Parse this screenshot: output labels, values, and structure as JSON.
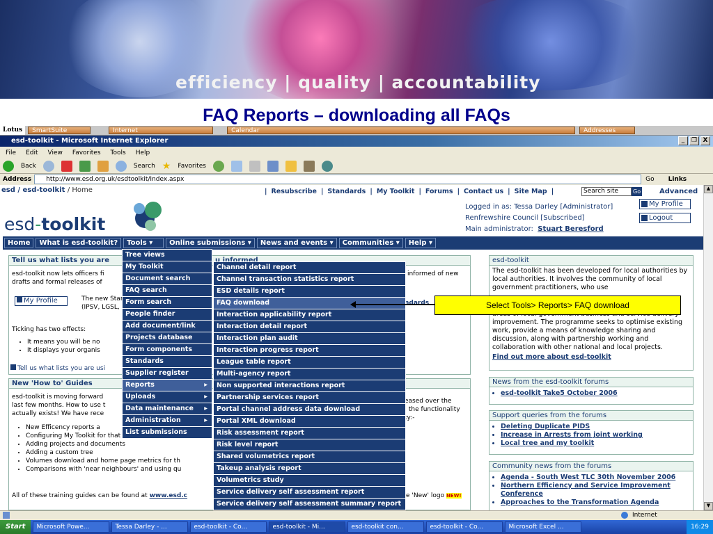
{
  "banner": {
    "tagline": "efficiency | quality | accountability"
  },
  "slide_title": "FAQ Reports – downloading all FAQs",
  "lotus_bar": {
    "brand": "Lotus",
    "items": [
      "SmartSuite",
      "Internet",
      "Calendar",
      "Addresses"
    ]
  },
  "window": {
    "title": "esd-toolkit - Microsoft Internet Explorer",
    "buttons": [
      "_",
      "❐",
      "X"
    ]
  },
  "menubar": [
    "File",
    "Edit",
    "View",
    "Favorites",
    "Tools",
    "Help"
  ],
  "toolbar": {
    "back": "Back",
    "search": "Search",
    "favorites": "Favorites"
  },
  "address": {
    "label": "Address",
    "url": "http://www.esd.org.uk/esdtoolkit/Index.aspx",
    "go": "Go",
    "links": "Links"
  },
  "site": {
    "crumb_root": "esd / esd-toolkit",
    "crumb_home": "/ Home",
    "toplinks": [
      "Resubscribe",
      "Standards",
      "My Toolkit",
      "Forums",
      "Contact us",
      "Site Map"
    ],
    "search_placeholder": "Search site",
    "search_go": "Go",
    "advanced": "Advanced",
    "logo_a": "esd",
    "logo_dash": "-",
    "logo_b": "toolkit",
    "logged_in": "Logged in as: Tessa Darley  [Administrator]",
    "council": "Renfrewshire Council  [Subscribed]",
    "main_admin_label": "Main administrator:",
    "main_admin": "Stuart Beresford",
    "my_profile": "My Profile",
    "logout": "Logout",
    "nav": [
      "Home",
      "What is esd-toolkit?",
      "Tools ▾",
      "Online submissions ▾",
      "News and events ▾",
      "Communities ▾",
      "Help ▾"
    ]
  },
  "tell_us": {
    "title": "Tell us what lists you are",
    "title_tail": "u informed",
    "p1": "esd-toolkit now lets officers fi",
    "p1b": "drafts and formal releases of",
    "p1_tail": "informed of new",
    "my_profile_btn": "My Profile",
    "p2": "The new Stand",
    "p2b": "(IPSV, LGSL, e",
    "p2_tail": "ndards",
    "ticking": "Ticking has two effects:",
    "bullets": [
      "It means you will be no",
      "It displays your organis"
    ],
    "footer_link": "Tell us what lists you are usi"
  },
  "howto": {
    "title": "New 'How to' Guides",
    "p1a": "esd-toolkit is moving forward",
    "p1b": "last few months. How to use t",
    "p1c": "actually exists! We have rece",
    "tail1": "eased over the",
    "tail2": ": the functionality",
    "tail3": "ty:-",
    "bullets": [
      "New Efficency reports a",
      "Configuring My Toolkit for that personal, custom",
      "Adding projects and documents",
      "Adding a custom tree",
      "Volumes download and home page metrics for th",
      "Comparisons with 'near neighbours' and using qu"
    ],
    "footer": "All of these training guides can be found at",
    "footer_link": "www.esd.c",
    "footer_tail": "e 'New' logo",
    "new_badge": "NEW!"
  },
  "right": {
    "about_title": "esd-toolkit",
    "about_text": "The esd-toolkit has been developed for local authorities by local authorities. It involves the community of local government practitioners, who use",
    "about_text2": "areas of local government business and service delivery improvement. The programme seeks to optimise existing work, provide a means of knowledge sharing and discussion, along with partnership working and collaboration with other national and local projects.",
    "about_link": "Find out more about esd-toolkit",
    "news_title": "News from the esd-toolkit forums",
    "news_items": [
      "esd-toolkit Take5 October 2006"
    ],
    "support_title": "Support queries from the forums",
    "support_items": [
      "Deleting Duplicate PIDS",
      "Increase in Arrests from joint working",
      "Local tree and my toolkit"
    ],
    "community_title": "Community news from the forums",
    "community_items": [
      "Agenda - South West TLC 30th November 2006",
      "Northern Efficiency and Service Improvement Conference",
      "Approaches to the Transformation Agenda"
    ]
  },
  "tools_menu": [
    "Tree views",
    "My Toolkit",
    "Document search",
    "FAQ search",
    "Form search",
    "People finder",
    "Add document/link",
    "Projects database",
    "Form components",
    "Standards",
    "Supplier register",
    "Reports",
    "Uploads",
    "Data maintenance",
    "Administration",
    "List submissions"
  ],
  "reports_menu": [
    "Channel detail report",
    "Channel transaction statistics report",
    "ESD details report",
    "FAQ download",
    "Interaction applicability report",
    "Interaction detail report",
    "Interaction plan audit",
    "Interaction progress report",
    "League table report",
    "Multi-agency report",
    "Non supported interactions report",
    "Partnership services report",
    "Portal channel address data download",
    "Portal XML download",
    "Risk assessment report",
    "Risk level report",
    "Shared volumetrics report",
    "Takeup analysis report",
    "Volumetrics study",
    "Service delivery self assessment report",
    "Service delivery self assessment summary report"
  ],
  "callout": "Select Tools> Reports> FAQ download",
  "statusbar": {
    "zone": "Internet"
  },
  "taskbar": {
    "start": "Start",
    "tasks": [
      "Microsoft Powe...",
      "Tessa Darley - ...",
      "esd-toolkit - Co...",
      "esd-toolkit - Mi...",
      "esd-toolkit con...",
      "esd-toolkit - Co...",
      "Microsoft Excel ..."
    ],
    "clock": "16:29"
  }
}
